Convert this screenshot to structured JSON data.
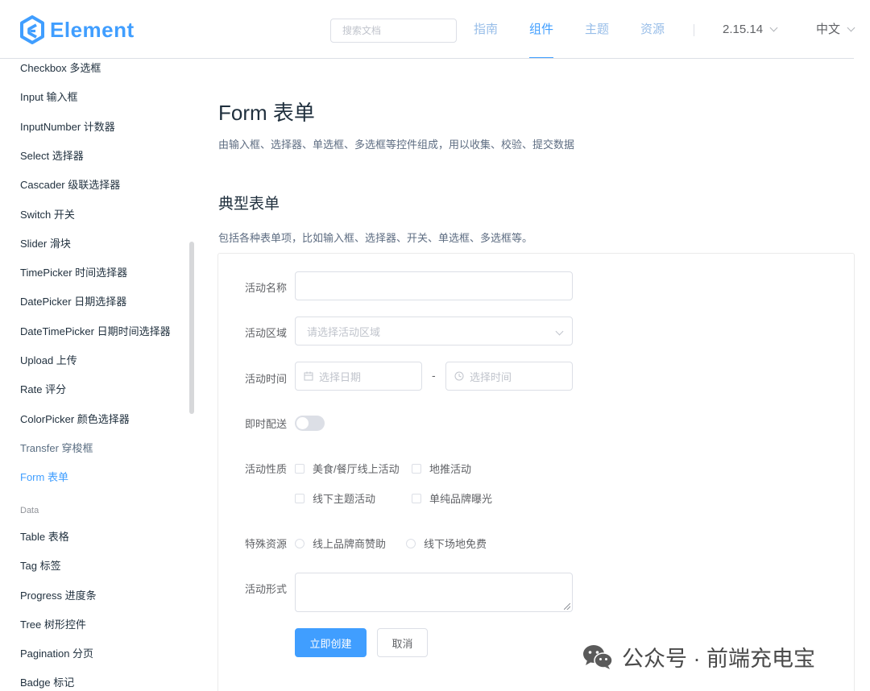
{
  "header": {
    "brand": "Element",
    "search_placeholder": "搜索文档",
    "nav": [
      "指南",
      "组件",
      "主题",
      "资源"
    ],
    "version": "2.15.14",
    "language": "中文"
  },
  "sidebar": {
    "items": [
      "Checkbox 多选框",
      "Input 输入框",
      "InputNumber 计数器",
      "Select 选择器",
      "Cascader 级联选择器",
      "Switch 开关",
      "Slider 滑块",
      "TimePicker 时间选择器",
      "DatePicker 日期选择器",
      "DateTimePicker 日期时间选择器",
      "Upload 上传",
      "Rate 评分",
      "ColorPicker 颜色选择器",
      "Transfer 穿梭框",
      "Form 表单"
    ],
    "group": "Data",
    "data_items": [
      "Table 表格",
      "Tag 标签",
      "Progress 进度条",
      "Tree 树形控件",
      "Pagination 分页",
      "Badge 标记"
    ]
  },
  "main": {
    "title": "Form 表单",
    "description": "由输入框、选择器、单选框、多选框等控件组成，用以收集、校验、提交数据",
    "section_title": "典型表单",
    "section_description": "包括各种表单项，比如输入框、选择器、开关、单选框、多选框等。"
  },
  "form": {
    "labels": {
      "name": "活动名称",
      "region": "活动区域",
      "time": "活动时间",
      "delivery": "即时配送",
      "type": "活动性质",
      "resource": "特殊资源",
      "desc": "活动形式"
    },
    "name_value": "",
    "region_placeholder": "请选择活动区域",
    "date_placeholder": "选择日期",
    "time_separator": "-",
    "time_placeholder": "选择时间",
    "delivery_on": false,
    "type_options": [
      "美食/餐厅线上活动",
      "地推活动",
      "线下主题活动",
      "单纯品牌曝光"
    ],
    "resource_options": [
      "线上品牌商赞助",
      "线下场地免费"
    ],
    "submit": "立即创建",
    "cancel": "取消"
  },
  "colors": {
    "primary": "#409eff",
    "text": "#1f2f3d",
    "label": "#606266",
    "border": "#dcdfe6",
    "placeholder": "#c0c4cc"
  },
  "watermark": "公众号 · 前端充电宝"
}
